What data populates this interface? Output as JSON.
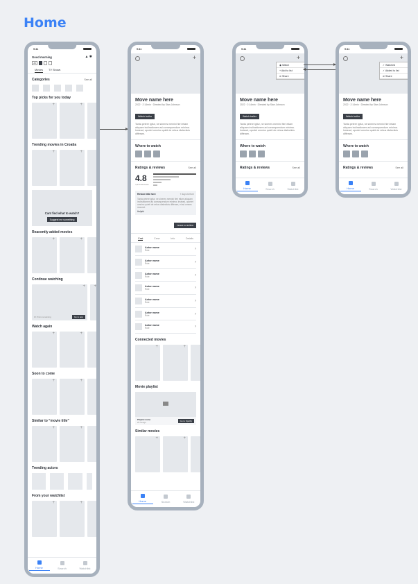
{
  "page_title": "Home",
  "status_time": "9:41",
  "tabbar": {
    "home": "Home",
    "search": "Search",
    "watchlist": "Watchlist"
  },
  "home": {
    "greeting": "Good morning",
    "tabs": [
      "Movies",
      "TV Shows"
    ],
    "sections": {
      "categories": "Categories",
      "see_all": "See all",
      "top_picks": "Top picks for you today",
      "trending_croatia": "Trending movies in Croatia",
      "recently_added": "Reacently added movies",
      "continue_watching": "Continue watching",
      "watch_again": "Watch again",
      "soon": "Soon to come",
      "similar": "Similar to “movie title”",
      "trending_actors": "Trending actors",
      "watchlist": "From your watchlist"
    },
    "banner": {
      "text": "Cant find what to watch?",
      "button": "Suggest me something"
    },
    "continue": {
      "label": "1h 5min remaining",
      "button": "Go to app"
    }
  },
  "detail": {
    "title": "Move name here",
    "meta": "2022 · 2:14min · Directed by Stan Johnson",
    "trailer": "Watch trailer",
    "description": "Tanta petere igitur, ne sineres memini fieri etiam aliquam inclinationem ad consequendum minima. Instead, oportet omnino quieti de rebus dialecticis differam.",
    "where": "Where to watch",
    "ratings": "Ratings & reviews",
    "see_all": "See all",
    "rating_value": "4.8",
    "rating_count": "4,474 Reviews",
    "review": {
      "title": "Review title here",
      "when": "7 days before",
      "text": "Tanta petere igitur, ne sineres memini fieri etiam aliquam inclinationem ad consequendum minima. Instead, oportet omnino quieti de rebus dialecticis differam, et ad omnes recurrat.",
      "helpful": "Helpful",
      "leave": "Leave a review"
    },
    "cast_tabs": [
      "Cast",
      "Crew",
      "Info",
      "Details"
    ],
    "actors": [
      {
        "name": "Actor name",
        "role": "Role"
      },
      {
        "name": "Actor name",
        "role": "Role"
      },
      {
        "name": "Actor name",
        "role": "Role"
      },
      {
        "name": "Actor name",
        "role": "Role"
      },
      {
        "name": "Actor name",
        "role": "Role"
      },
      {
        "name": "Actor name",
        "role": "Role"
      },
      {
        "name": "Actor name",
        "role": "Role"
      }
    ],
    "connected": "Connected movies",
    "playlist": "Movie playlist",
    "playlist_name": "Playlist name",
    "playlist_songs": "23 Songs",
    "spotify": "Go to Spotify",
    "similar": "Similar movies"
  },
  "menu1": [
    "Watch",
    "Add to list",
    "Share"
  ],
  "menu2": [
    "Watched",
    "Added to list",
    "Share"
  ]
}
